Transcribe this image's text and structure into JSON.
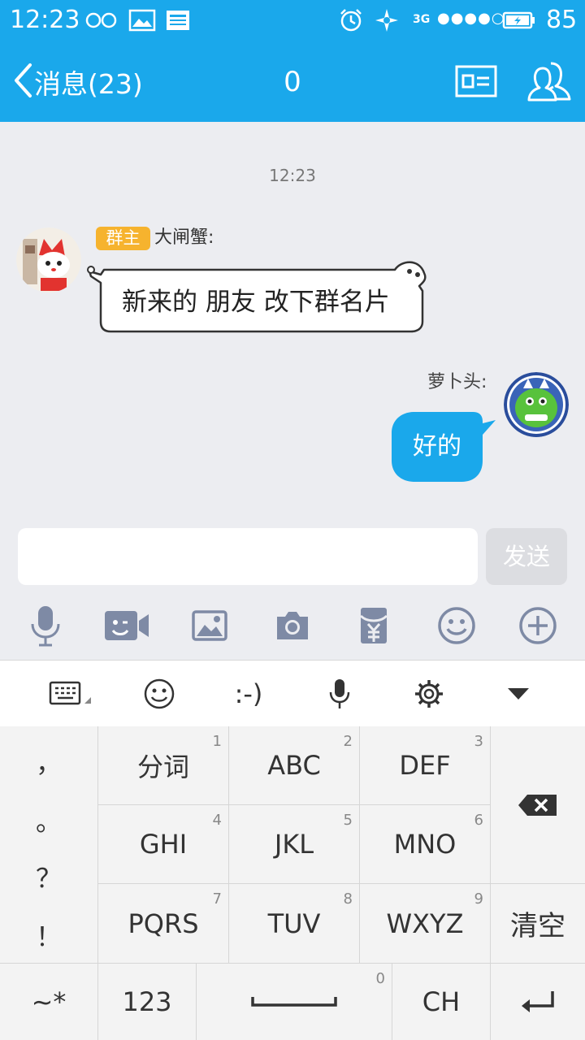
{
  "status_bar": {
    "time": "12:23",
    "network": "3G",
    "signal": "●●●●○",
    "battery": "85"
  },
  "header": {
    "back_label": "消息(23)",
    "title": "0"
  },
  "chat": {
    "timestamp": "12:23",
    "messages": [
      {
        "side": "left",
        "badge": "群主",
        "sender": "大闸蟹:",
        "text": "新来的 朋友  改下群名片"
      },
      {
        "side": "right",
        "sender": "萝卜头:",
        "text": "好的"
      }
    ]
  },
  "input": {
    "value": "",
    "placeholder": "",
    "send_label": "发送"
  },
  "toolbar_icons": [
    "microphone-icon",
    "video-call-icon",
    "image-icon",
    "camera-icon",
    "red-packet-icon",
    "emoji-icon",
    "plus-icon"
  ],
  "keyboard": {
    "toolbar": {
      "emoticon_text": ":-)"
    },
    "punctuation": [
      "，",
      "。",
      "？",
      "！"
    ],
    "keys": [
      {
        "label": "分词",
        "num": "1"
      },
      {
        "label": "ABC",
        "num": "2"
      },
      {
        "label": "DEF",
        "num": "3"
      },
      {
        "label": "GHI",
        "num": "4"
      },
      {
        "label": "JKL",
        "num": "5"
      },
      {
        "label": "MNO",
        "num": "6"
      },
      {
        "label": "PQRS",
        "num": "7"
      },
      {
        "label": "TUV",
        "num": "8"
      },
      {
        "label": "WXYZ",
        "num": "9"
      }
    ],
    "clear_label": "清空",
    "symbol_label": "~*",
    "number_label": "123",
    "space_num": "0",
    "lang_label": "CH"
  },
  "colors": {
    "accent": "#1aa8eb",
    "background": "#ecedf1",
    "owner_badge": "#f6b32e",
    "my_bubble": "#1aa8eb"
  }
}
